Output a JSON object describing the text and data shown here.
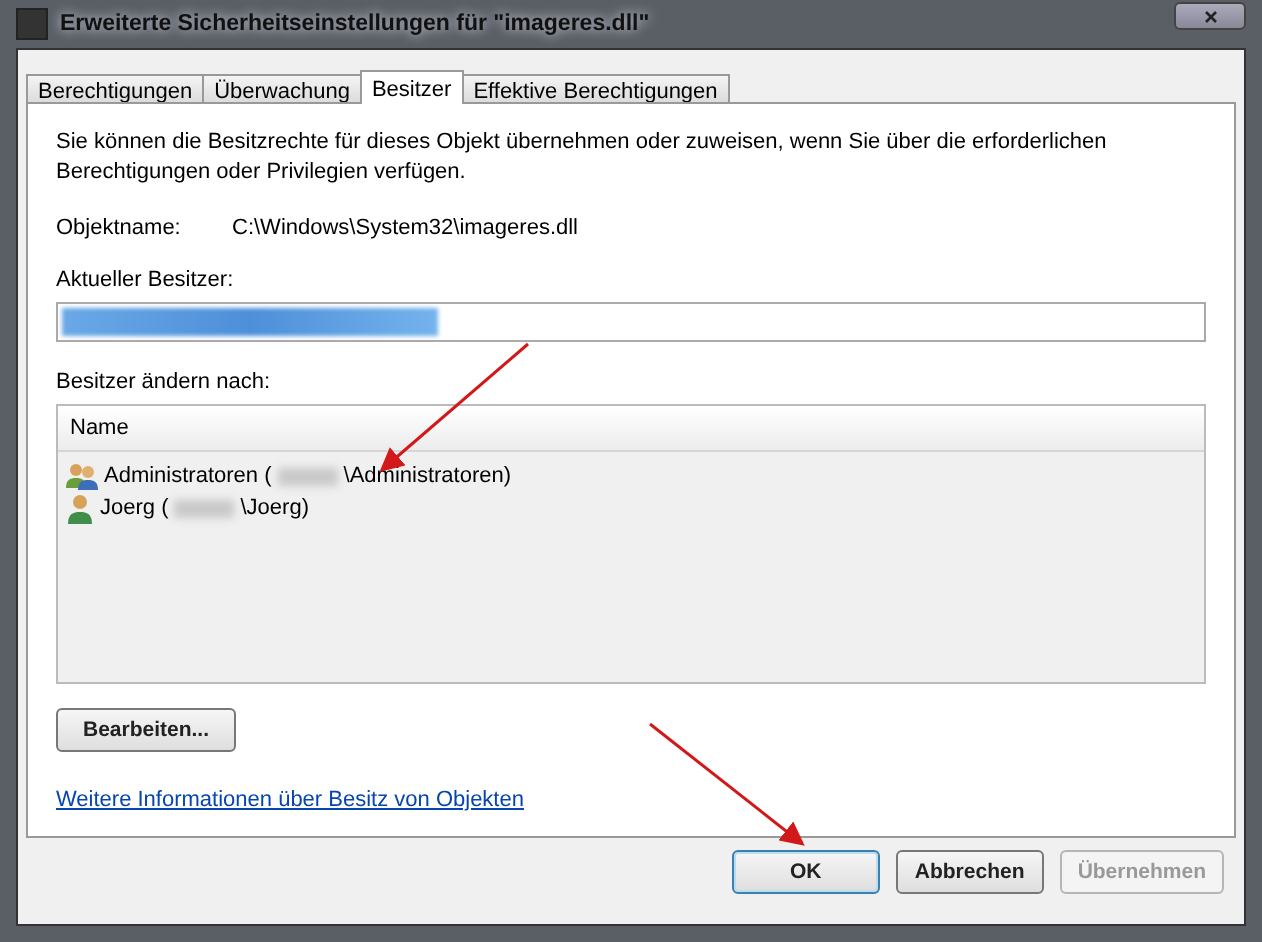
{
  "window": {
    "title": "Erweiterte Sicherheitseinstellungen für \"imageres.dll\""
  },
  "tabs": [
    {
      "label": "Berechtigungen",
      "selected": false
    },
    {
      "label": "Überwachung",
      "selected": false
    },
    {
      "label": "Besitzer",
      "selected": true
    },
    {
      "label": "Effektive Berechtigungen",
      "selected": false
    }
  ],
  "intro": "Sie können die Besitzrechte für dieses Objekt übernehmen oder zuweisen, wenn Sie über die erforderlichen Berechtigungen oder Privilegien verfügen.",
  "object_name": {
    "label": "Objektname:",
    "value": "C:\\Windows\\System32\\imageres.dll"
  },
  "current_owner": {
    "label": "Aktueller Besitzer:"
  },
  "change_owner": {
    "label": "Besitzer ändern nach:",
    "columns": [
      "Name"
    ],
    "rows": [
      {
        "kind": "group",
        "before": "Administratoren (",
        "after": "\\Administratoren)"
      },
      {
        "kind": "user",
        "before": "Joerg (",
        "after": "\\Joerg)"
      }
    ]
  },
  "edit_button": "Bearbeiten...",
  "link": "Weitere Informationen über Besitz von Objekten",
  "buttons": [
    {
      "label": "OK",
      "disabled": false,
      "default": true
    },
    {
      "label": "Abbrechen",
      "disabled": false,
      "default": false
    },
    {
      "label": "Übernehmen",
      "disabled": true,
      "default": false
    }
  ]
}
